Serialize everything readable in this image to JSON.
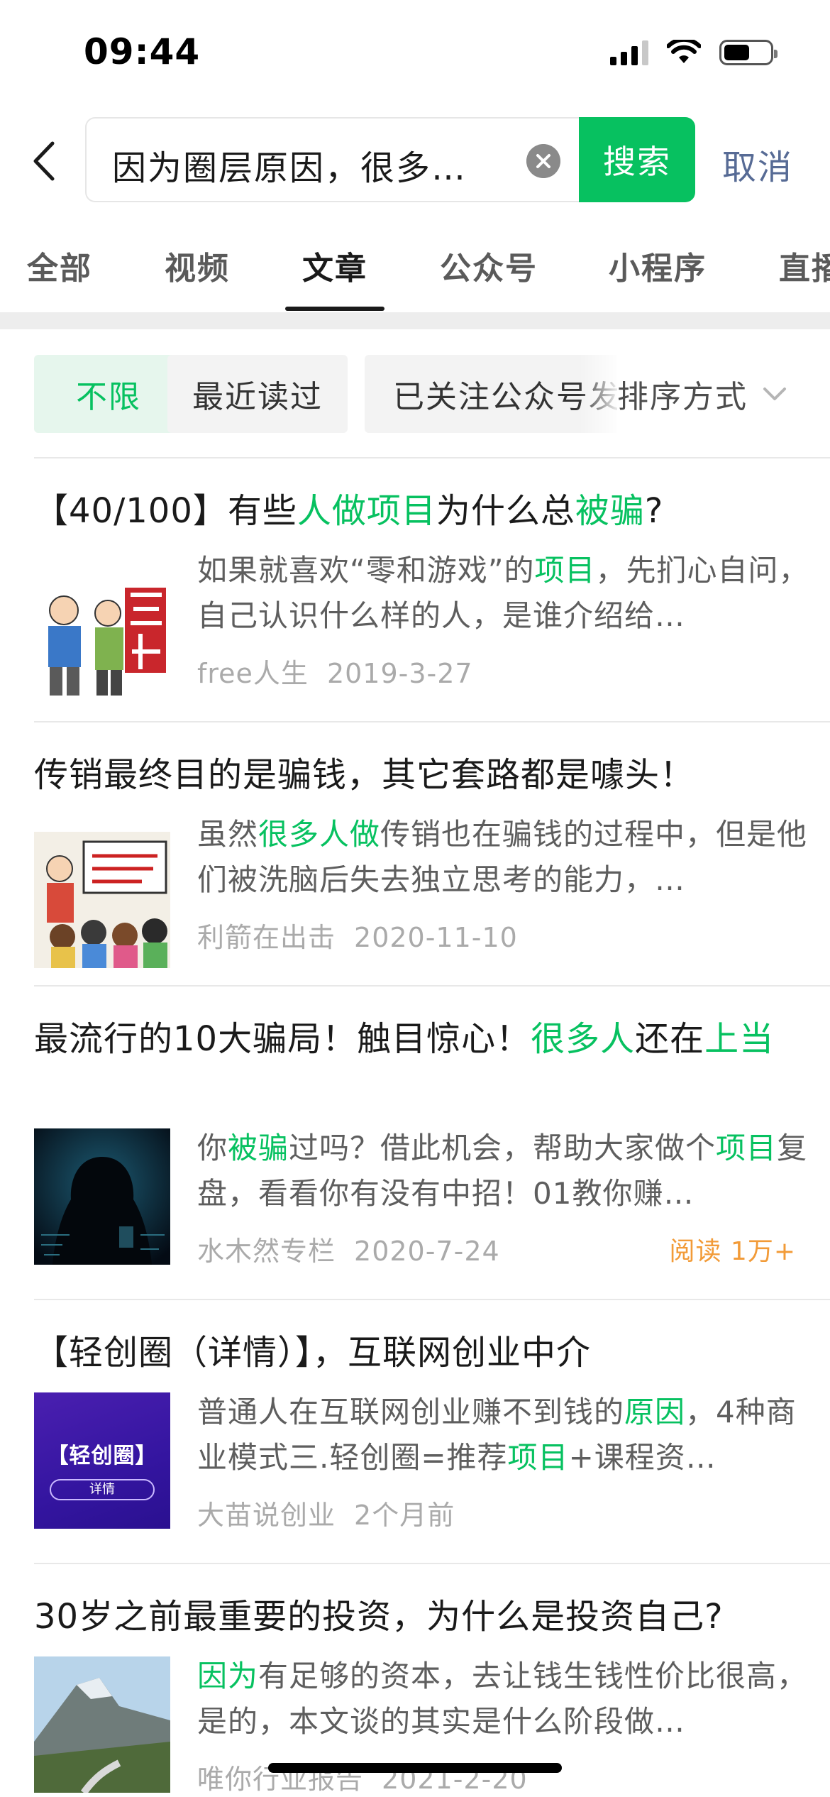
{
  "status_bar": {
    "time": "09:44",
    "signal_bars": 4,
    "battery_level_pct": 55
  },
  "search": {
    "query": "因为圈层原因，很多…",
    "button_label": "搜索",
    "cancel_label": "取消"
  },
  "tabs": [
    {
      "label": "全部"
    },
    {
      "label": "视频"
    },
    {
      "label": "文章",
      "active": true
    },
    {
      "label": "公众号"
    },
    {
      "label": "小程序"
    },
    {
      "label": "直播"
    }
  ],
  "filters": {
    "chips": [
      "不限",
      "最近读过",
      "已关注公众号发"
    ],
    "selected": "不限",
    "sort_label": "排序方式"
  },
  "results": [
    {
      "title_segments": [
        {
          "text": "【40/100】有些",
          "hl": false
        },
        {
          "text": "人做项目",
          "hl": true
        },
        {
          "text": "为什么总",
          "hl": false
        },
        {
          "text": "被骗",
          "hl": true
        },
        {
          "text": "?",
          "hl": false
        }
      ],
      "desc_segments": [
        {
          "text": "如果就喜欢“零和游戏”的",
          "hl": false
        },
        {
          "text": "项目",
          "hl": true
        },
        {
          "text": "，先扪心自问，自己认识什么样的人，是谁介绍给…",
          "hl": false
        }
      ],
      "source": "free人生",
      "date": "2019-3-27",
      "thumb": "cartoon-scam"
    },
    {
      "title_segments": [
        {
          "text": "传销最终目的是骗钱，其它套路都是噱头！",
          "hl": false
        }
      ],
      "desc_segments": [
        {
          "text": "虽然",
          "hl": false
        },
        {
          "text": "很多人做",
          "hl": true
        },
        {
          "text": "传销也在骗钱的过程中，但是他们被洗脑后失去独立思考的能力，…",
          "hl": false
        }
      ],
      "source": "利箭在出击",
      "date": "2020-11-10",
      "thumb": "cartoon-class"
    },
    {
      "title_segments": [
        {
          "text": "最流行的10大骗局！触目惊心！",
          "hl": false
        },
        {
          "text": "很多人",
          "hl": true
        },
        {
          "text": "还在",
          "hl": false
        },
        {
          "text": "上当",
          "hl": true
        }
      ],
      "desc_segments": [
        {
          "text": "你",
          "hl": false
        },
        {
          "text": "被骗",
          "hl": true
        },
        {
          "text": "过吗？借此机会，帮助大家做个",
          "hl": false
        },
        {
          "text": "项目",
          "hl": true
        },
        {
          "text": "复盘，看看你有没有中招！01教你赚…",
          "hl": false
        }
      ],
      "source": "水木然专栏",
      "date": "2020-7-24",
      "read_count": "阅读 1万+",
      "thumb": "hacker"
    },
    {
      "title_segments": [
        {
          "text": "【轻创圈（详情）】，互联网创业中介",
          "hl": false
        }
      ],
      "desc_segments": [
        {
          "text": "普通人在互联网创业赚不到钱的",
          "hl": false
        },
        {
          "text": "原因",
          "hl": true
        },
        {
          "text": "，4种商业模式三.轻创圈=推荐",
          "hl": false
        },
        {
          "text": "项目",
          "hl": true
        },
        {
          "text": "+课程资…",
          "hl": false
        }
      ],
      "source": "大苗说创业",
      "date": "2个月前",
      "thumb": "purple-card",
      "thumb_title": "【轻创圈】",
      "thumb_button": "详情"
    },
    {
      "title_segments": [
        {
          "text": "30岁之前最重要的投资，为什么是投资自己?",
          "hl": false
        }
      ],
      "desc_segments": [
        {
          "text": "因为",
          "hl": true
        },
        {
          "text": "有足够的资本，去让钱生钱性价比很高，是的，本文谈的其实是什么阶段做…",
          "hl": false
        }
      ],
      "source": "唯你行业报告",
      "date": "2021-2-20",
      "thumb": "mountain"
    }
  ],
  "colors": {
    "accent": "#07c160",
    "cancel": "#576b95",
    "read_count": "#f29b38"
  }
}
